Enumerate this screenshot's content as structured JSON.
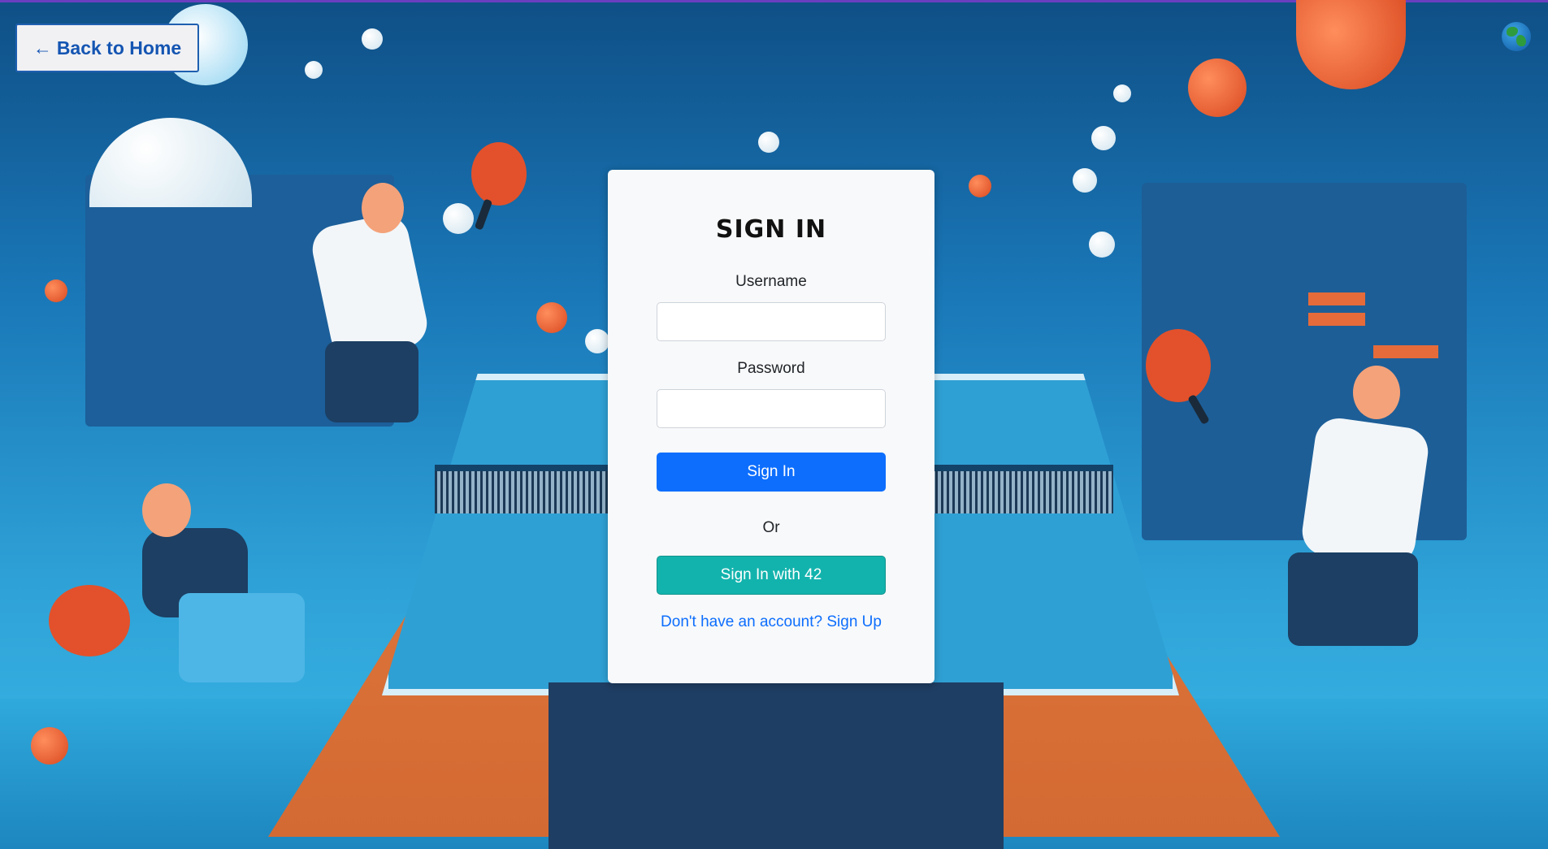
{
  "nav": {
    "back_label": "Back to Home",
    "back_arrow": "←",
    "language_icon": "globe-icon"
  },
  "login": {
    "title": "SIGN IN",
    "username_label": "Username",
    "username_value": "",
    "password_label": "Password",
    "password_value": "",
    "sign_in_label": "Sign In",
    "or_label": "Or",
    "sign_in_42_label": "Sign In with 42",
    "signup_link": "Don't have an account? Sign Up"
  },
  "colors": {
    "primary": "#0d6efd",
    "teal": "#13b3ad",
    "back_text": "#1455b2",
    "card_bg": "#f8f9fa"
  }
}
